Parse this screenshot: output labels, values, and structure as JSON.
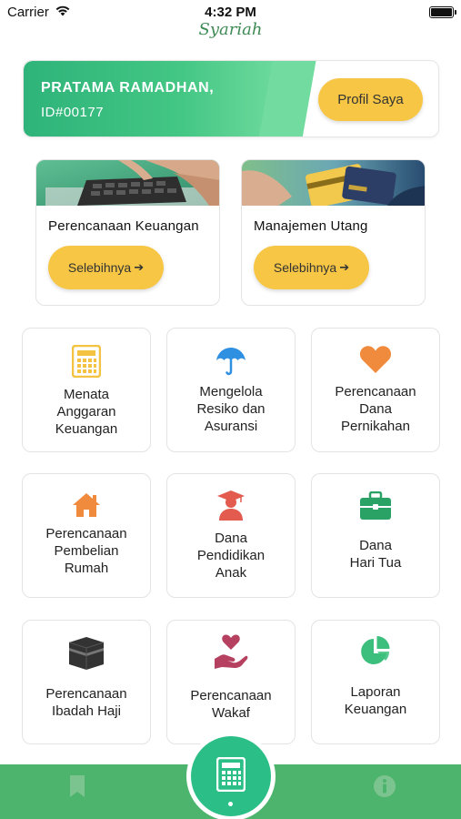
{
  "status_bar": {
    "carrier": "Carrier",
    "time": "4:32 PM"
  },
  "brand": "Syariah",
  "profile": {
    "name": "PRATAMA RAMADHAN,",
    "id": "ID#00177",
    "button_label": "Profil Saya"
  },
  "feature_cards": [
    {
      "title": "Perencanaan Keuangan",
      "button_label": "Selebihnya",
      "arrow": "➔",
      "image": "calculator-hands-photo"
    },
    {
      "title": "Manajemen Utang",
      "button_label": "Selebihnya",
      "arrow": "➔",
      "image": "credit-cards-photo"
    }
  ],
  "tiles": [
    {
      "label": "Menata\nAnggaran\nKeuangan",
      "icon": "calculator-icon",
      "color": "#f5c342"
    },
    {
      "label": "Mengelola\nResiko dan\nAsuransi",
      "icon": "umbrella-icon",
      "color": "#2f8fe0"
    },
    {
      "label": "Perencanaan\nDana\nPernikahan",
      "icon": "heart-icon",
      "color": "#f08a3c"
    },
    {
      "label": "Perencanaan\nPembelian\nRumah",
      "icon": "house-icon",
      "color": "#f08a3c"
    },
    {
      "label": "Dana\nPendidikan\nAnak",
      "icon": "graduate-icon",
      "color": "#e25b4e"
    },
    {
      "label": "Dana\nHari Tua",
      "icon": "briefcase-icon",
      "color": "#2aa165"
    },
    {
      "label": "Perencanaan\nIbadah Haji",
      "icon": "kaaba-icon",
      "color": "#333333"
    },
    {
      "label": "Perencanaan\nWakaf",
      "icon": "hand-heart-icon",
      "color": "#b5405f"
    },
    {
      "label": "Laporan\nKeuangan",
      "icon": "pie-chart-icon",
      "color": "#3cbf7c"
    }
  ],
  "bottom_nav": {
    "left_icon": "bookmark-icon",
    "center_icon": "calculator-icon",
    "right_icon": "info-icon"
  },
  "colors": {
    "accent_green": "#4cb46c",
    "button_yellow": "#f6c644",
    "fab_green": "#2bbf87"
  }
}
